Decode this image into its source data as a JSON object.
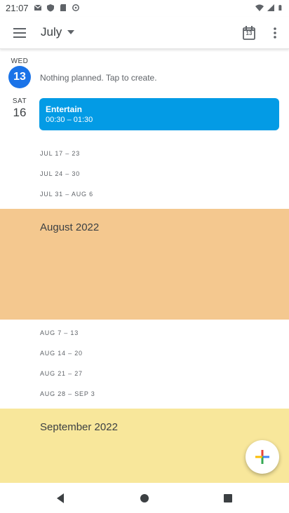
{
  "status_bar": {
    "time": "21:07",
    "left_icons": [
      "gmail-icon",
      "shield-icon",
      "sd-card-icon",
      "sync-icon"
    ],
    "right_icons": [
      "wifi-icon",
      "signal-icon",
      "battery-icon"
    ]
  },
  "app_bar": {
    "month_title": "July",
    "today_date": "13"
  },
  "schedule": {
    "today": {
      "weekday": "WED",
      "day": "13",
      "empty_text": "Nothing planned. Tap to create."
    },
    "sat": {
      "weekday": "SAT",
      "day": "16"
    },
    "event": {
      "title": "Entertain",
      "time": "00:30 – 01:30",
      "color": "#039be5"
    },
    "july_weeks": [
      "JUL 17 – 23",
      "JUL 24 – 30",
      "JUL 31 – AUG 6"
    ],
    "august_banner": {
      "title": "August 2022",
      "color": "#f4c88f"
    },
    "august_weeks": [
      "AUG 7 – 13",
      "AUG 14 – 20",
      "AUG 21 – 27",
      "AUG 28 – SEP 3"
    ],
    "september_banner": {
      "title": "September 2022",
      "color": "#f8e79b"
    }
  },
  "colors": {
    "accent": "#1a73e8"
  }
}
